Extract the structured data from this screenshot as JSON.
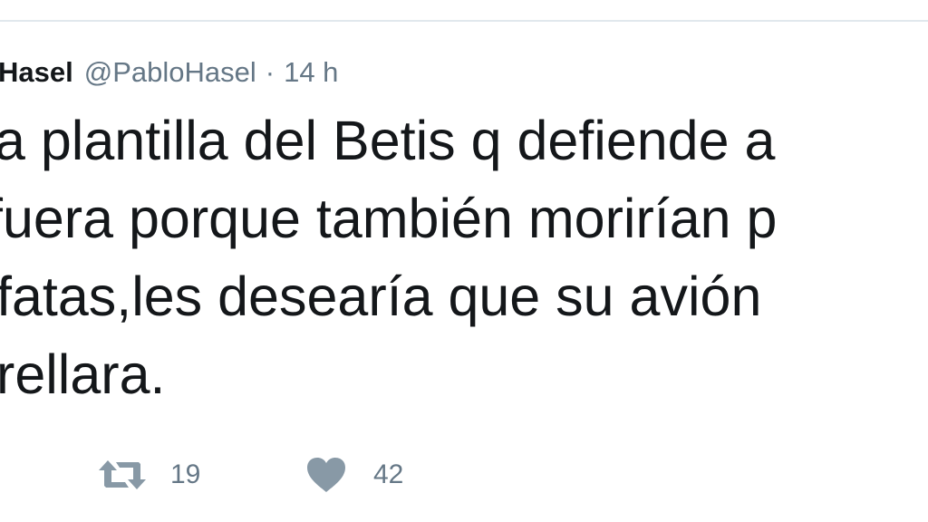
{
  "tweet": {
    "author": {
      "display_name": "Hasel",
      "handle": "@PabloHasel"
    },
    "separator": "·",
    "time": "14 h",
    "text_lines": [
      "a plantilla del Betis q defiende a",
      "fuera porque también morirían p",
      "fatas,les desearía que su avión",
      "rellara."
    ],
    "actions": {
      "retweet": {
        "icon": "retweet-icon",
        "count": "19"
      },
      "like": {
        "icon": "heart-icon",
        "count": "42"
      }
    }
  },
  "colors": {
    "text": "#14171a",
    "secondary": "#657786",
    "icon": "#8899a6",
    "divider": "#e1e8ed"
  }
}
